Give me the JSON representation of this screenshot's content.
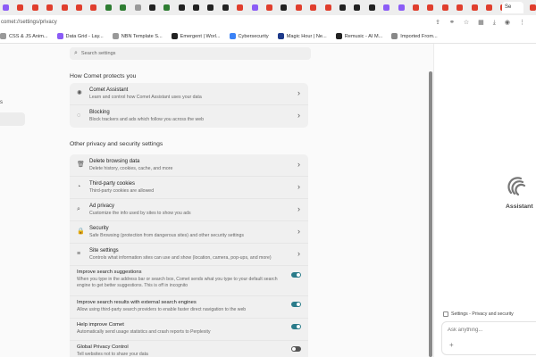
{
  "tabs": {
    "favicon_colors": [
      "#8b5cf6",
      "#e03e2d",
      "#e03e2d",
      "#e03e2d",
      "#e03e2d",
      "#e03e2d",
      "#e03e2d",
      "#2e7d32",
      "#2e7d32",
      "#999999",
      "#222222",
      "#2e7d32",
      "#222222",
      "#222222",
      "#222222",
      "#222222",
      "#e03e2d",
      "#8b5cf6",
      "#e03e2d",
      "#222222",
      "#e03e2d",
      "#e03e2d",
      "#e03e2d",
      "#222222",
      "#222222",
      "#222222",
      "#8b5cf6",
      "#8b5cf6",
      "#e03e2d",
      "#e03e2d",
      "#e03e2d",
      "#e03e2d",
      "#e03e2d",
      "#e03e2d",
      "#e03e2d",
      "#e03e2d",
      "#e03e2d",
      "#e03e2d",
      "#e03e2d",
      "#222222",
      "#222222",
      "#222222",
      "#222222",
      "#222222",
      "#222222",
      "#222222",
      "#222222",
      "#222222",
      "#222222",
      "#222222",
      "#222222",
      "#222222",
      "#222222",
      "#222222",
      "#222222"
    ],
    "active_label": "Se"
  },
  "address": {
    "url": "comet://settings/privacy",
    "icons": [
      "share-icon",
      "link-icon",
      "star-icon",
      "extension-icon",
      "download-icon",
      "profile-icon",
      "menu-icon"
    ]
  },
  "bookmarks": [
    {
      "label": "CSS & JS Anim...",
      "color": "#999999"
    },
    {
      "label": "Data Grid - Lay...",
      "color": "#8b5cf6"
    },
    {
      "label": "NBN Template S...",
      "color": "#999999"
    },
    {
      "label": "Emergent | Worl...",
      "color": "#222222"
    },
    {
      "label": "Cybersecurity",
      "color": "#3b82f6"
    },
    {
      "label": "Magic Hour | Ne...",
      "color": "#1e3a8a"
    },
    {
      "label": "Remusic - AI M...",
      "color": "#222222"
    },
    {
      "label": "Imported From...",
      "color": "#888888"
    }
  ],
  "nav": {
    "partial_item": "s"
  },
  "search": {
    "placeholder": "Search settings"
  },
  "sections": {
    "protect_title": "How Comet protects you",
    "other_title": "Other privacy and security settings"
  },
  "protect_rows": [
    {
      "icon": "comet-assistant-icon",
      "glyph": "✺",
      "title": "Comet Assistant",
      "sub": "Learn and control how Comet Assistant uses your data"
    },
    {
      "icon": "blocking-icon",
      "glyph": "◌",
      "title": "Blocking",
      "sub": "Block trackers and ads which follow you across the web"
    }
  ],
  "other_rows": [
    {
      "icon": "trash-icon",
      "glyph": "🗑",
      "title": "Delete browsing data",
      "sub": "Delete history, cookies, cache, and more"
    },
    {
      "icon": "cookie-icon",
      "glyph": "◔",
      "title": "Third-party cookies",
      "sub": "Third-party cookies are allowed"
    },
    {
      "icon": "ad-privacy-icon",
      "glyph": "⌕",
      "title": "Ad privacy",
      "sub": "Customize the info used by sites to show you ads"
    },
    {
      "icon": "security-icon",
      "glyph": "🔒",
      "title": "Security",
      "sub": "Safe Browsing (protection from dangerous sites) and other security settings"
    },
    {
      "icon": "site-settings-icon",
      "glyph": "≡",
      "title": "Site settings",
      "sub": "Controls what information sites can use and show (location, camera, pop-ups, and more)"
    }
  ],
  "toggle_rows": [
    {
      "title": "Improve search suggestions",
      "sub": "When you type in the address bar or search box, Comet sends what you type to your default search engine to get better suggestions. This is off in incognito",
      "state": "on"
    },
    {
      "title": "Improve search results with external search engines",
      "sub": "Allow using third-party search providers to enable faster direct navigation to the web",
      "state": "on"
    },
    {
      "title": "Help improve Comet",
      "sub": "Automatically send usage statistics and crash reports to Perplexity",
      "state": "on"
    },
    {
      "title": "Global Privacy Control",
      "sub": "Tell websites not to share your data",
      "state": "off"
    }
  ],
  "assistant": {
    "label": "Assistant",
    "context_chip": "Settings - Privacy and security",
    "ask_placeholder": "Ask anything...",
    "plus": "+"
  },
  "colors": {
    "toggle_on": "#2a7b8a",
    "toggle_off": "#555555",
    "card_bg": "#f0f0f0"
  }
}
